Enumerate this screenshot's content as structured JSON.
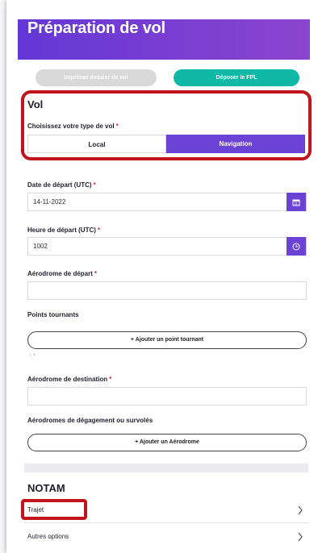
{
  "header": {
    "title": "Préparation de vol"
  },
  "actions": {
    "print_label": "Imprimer dossier de vol",
    "fpl_label": "Déposer le FPL"
  },
  "vol": {
    "title": "Vol",
    "type_label": "Choisissez votre type de vol",
    "required_mark": "*",
    "options": [
      "Local",
      "Navigation"
    ],
    "selected": "Navigation"
  },
  "form": {
    "date_label": "Date de départ (UTC)",
    "date_value": "14-11-2022",
    "time_label": "Heure de départ (UTC)",
    "time_value": "1002",
    "dep_label": "Aérodrome de départ",
    "dep_value": "",
    "turn_label": "Points tournants",
    "add_turn_label": "+ Ajouter un point tournant",
    "turn_meta": "1 ▾",
    "dest_label": "Aérodrome de destination",
    "dest_value": "",
    "alt_label": "Aérodromes de dégagement ou survolés",
    "add_alt_label": "+ Ajouter un Aérodrome"
  },
  "notam": {
    "title": "NOTAM",
    "items": [
      {
        "label": "Trajet"
      },
      {
        "label": "Autres options"
      }
    ]
  },
  "colors": {
    "accent": "#6a42d6",
    "teal": "#10b9a5",
    "highlight": "#c0151c"
  }
}
